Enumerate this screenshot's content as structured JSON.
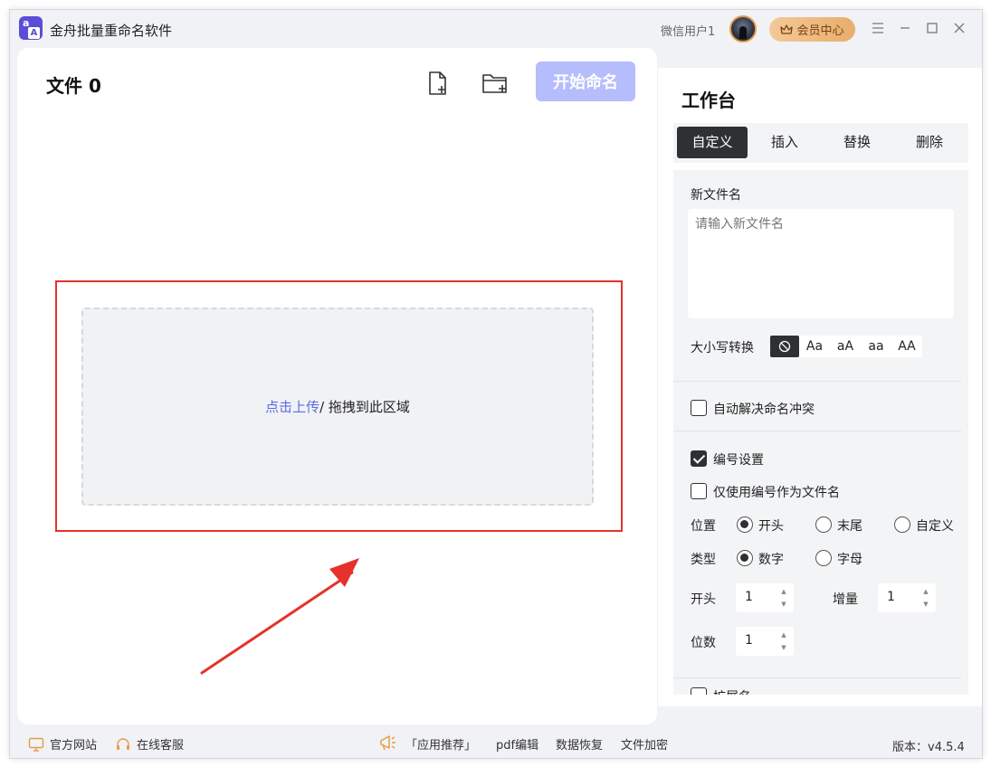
{
  "app": {
    "title": "金舟批量重命名软件",
    "logo_top": "a",
    "logo_bottom": "A"
  },
  "user": {
    "name": "微信用户1",
    "vip_label": "会员中心"
  },
  "main": {
    "file_count_label": "文件 0",
    "start_button": "开始命名",
    "dropzone": {
      "link_text": "点击上传",
      "rest_text": " / 拖拽到此区域"
    }
  },
  "workbench": {
    "title": "工作台",
    "tabs": [
      {
        "label": "自定义",
        "active": true
      },
      {
        "label": "插入",
        "active": false
      },
      {
        "label": "替换",
        "active": false
      },
      {
        "label": "删除",
        "active": false
      }
    ],
    "new_name_label": "新文件名",
    "new_name_placeholder": "请输入新文件名",
    "case_label": "大小写转换",
    "case_options": [
      "Aa",
      "aA",
      "aa",
      "AA"
    ],
    "auto_resolve_label": "自动解决命名冲突",
    "numbering_label": "编号设置",
    "only_number_label": "仅使用编号作为文件名",
    "position_label": "位置",
    "position_options": [
      "开头",
      "末尾",
      "自定义"
    ],
    "type_label": "类型",
    "type_options": [
      "数字",
      "字母"
    ],
    "start_label": "开头",
    "start_value": "1",
    "increment_label": "增量",
    "increment_value": "1",
    "digits_label": "位数",
    "digits_value": "1",
    "ext_label": "扩展名"
  },
  "footer": {
    "official_site": "官方网站",
    "online_service": "在线客服",
    "app_recommend": "「应用推荐」",
    "pdf_edit": "pdf编辑",
    "data_recovery": "数据恢复",
    "file_encrypt": "文件加密",
    "version": "版本：v4.5.4"
  },
  "colors": {
    "accent": "#5a6de6",
    "start_button": "#b5bdfc",
    "highlight_frame": "#e5322d",
    "dark": "#2f3033"
  }
}
